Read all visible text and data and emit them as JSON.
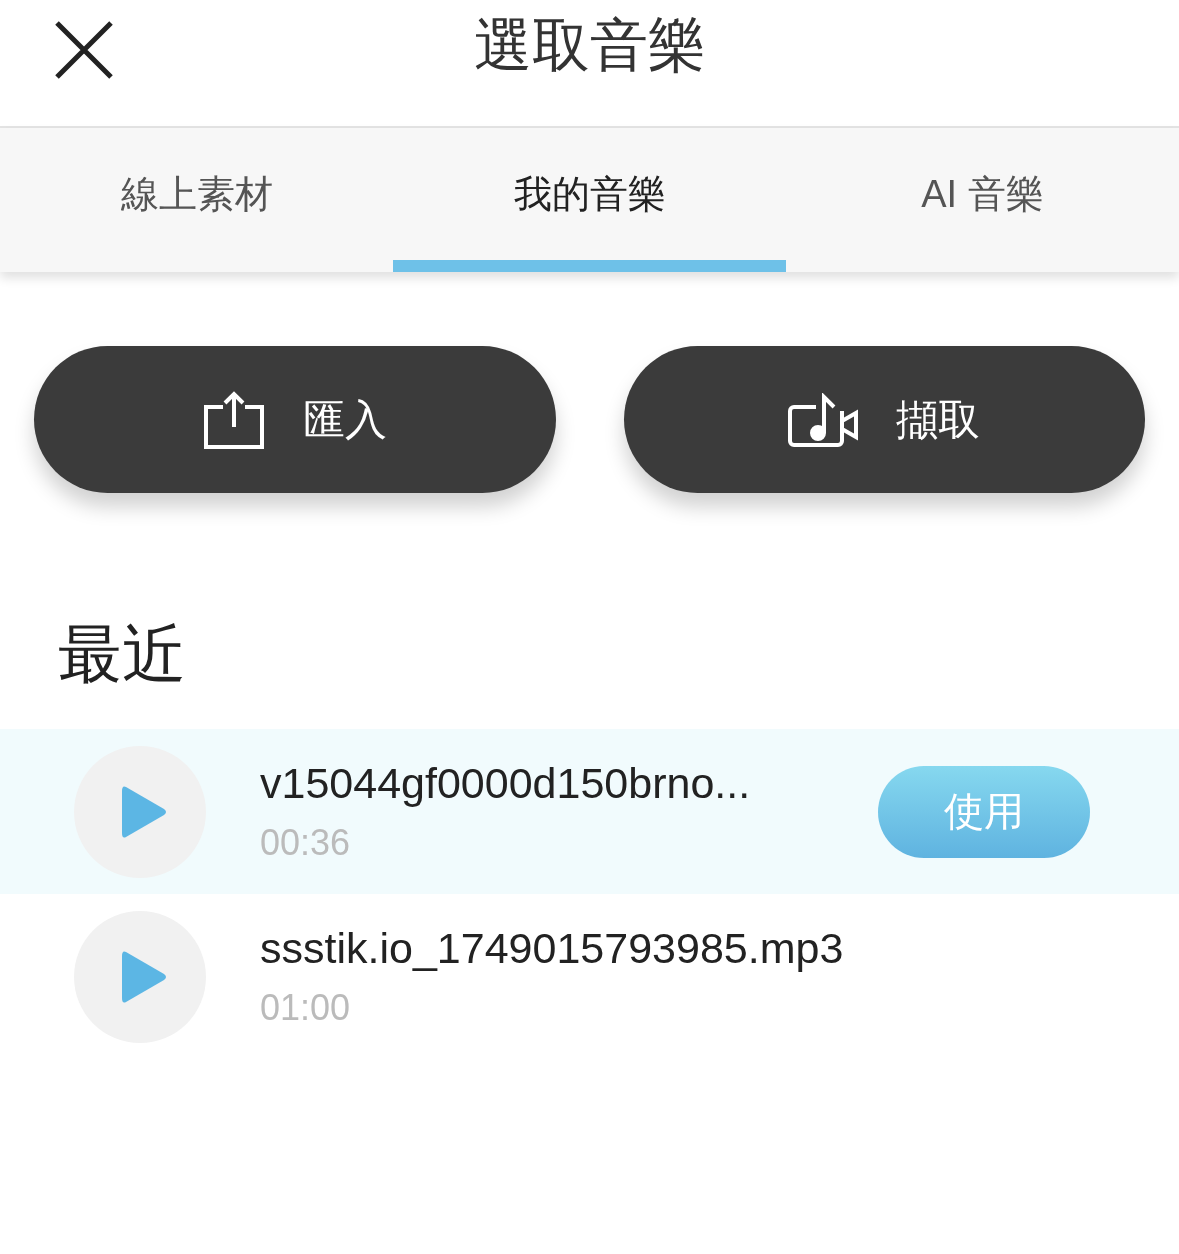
{
  "header": {
    "title": "選取音樂"
  },
  "tabs": [
    {
      "label": "線上素材",
      "selected": false
    },
    {
      "label": "我的音樂",
      "selected": true
    },
    {
      "label": "AI 音樂",
      "selected": false
    }
  ],
  "actions": [
    {
      "kind": "import",
      "label": "匯入"
    },
    {
      "kind": "capture",
      "label": "擷取"
    }
  ],
  "recent": {
    "heading": "最近",
    "use_label": "使用",
    "tracks": [
      {
        "name": "v15044gf0000d150brno...",
        "duration": "00:36",
        "selected": true
      },
      {
        "name": "ssstik.io_1749015793985.mp3",
        "duration": "01:00",
        "selected": false
      }
    ]
  }
}
